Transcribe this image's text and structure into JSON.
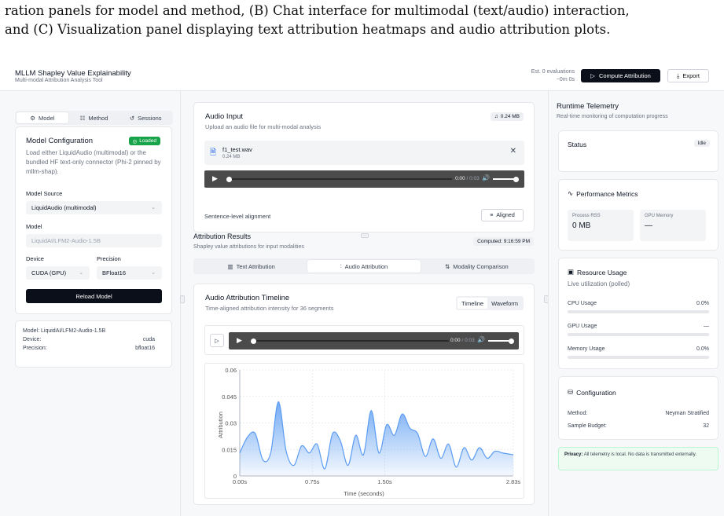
{
  "caption": {
    "line1": "ration panels for model and method, (B) Chat interface for multimodal (text/audio) interaction,",
    "line2": "and (C) Visualization panel displaying text attribution heatmaps and audio attribution plots."
  },
  "header": {
    "title": "MLLM Shapley Value Explainability",
    "subtitle": "Multi-modal Attribution Analysis Tool",
    "est_line1": "Est. 0 evaluations",
    "est_line2": "~0m 0s",
    "compute_label": "Compute Attribution",
    "export_label": "Export"
  },
  "left": {
    "tabs": [
      "Model",
      "Method",
      "Sessions"
    ],
    "config": {
      "title": "Model Configuration",
      "badge": "Loaded",
      "desc": "Load either LiquidAudio (multimodal) or the bundled HF text-only connector (Phi-2 pinned by mllm-shap).",
      "source_label": "Model Source",
      "source_value": "LiquidAudio (multimodal)",
      "model_label": "Model",
      "model_value": "LiquidAI/LFM2-Audio-1.5B",
      "device_label": "Device",
      "device_value": "CUDA (GPU)",
      "precision_label": "Precision",
      "precision_value": "BFloat16",
      "reload_label": "Reload Model"
    },
    "info": {
      "model_k": "Model:",
      "model_v": "LiquidAI/LFM2-Audio-1.5B",
      "device_k": "Device:",
      "device_v": "cuda",
      "precision_k": "Precision:",
      "precision_v": "bfloat16"
    }
  },
  "center": {
    "audio_input": {
      "title": "Audio Input",
      "subtitle": "Upload an audio file for multi-modal analysis",
      "size": "0.24 MB",
      "file_name": "f1_test.wav",
      "file_size": "0.24 MB",
      "time": "0:00",
      "duration": "/ 0:03",
      "alignment_label": "Sentence-level alignment",
      "aligned_label": "Aligned"
    },
    "results": {
      "title": "Attribution Results",
      "subtitle": "Shapley value attributions for input modalities",
      "computed": "Computed: 9:16:59 PM",
      "tabs": [
        "Text Attribution",
        "Audio Attribution",
        "Modality Comparison"
      ]
    },
    "timeline": {
      "title": "Audio Attribution Timeline",
      "subtitle": "Time-aligned attribution intensity for 36 segments",
      "view_timeline": "Timeline",
      "view_waveform": "Waveform",
      "time": "0:00",
      "duration": "/ 0:03"
    }
  },
  "chart_data": {
    "type": "area",
    "xlabel": "Time (seconds)",
    "ylabel": "Attribution",
    "xlim": [
      0,
      2.83
    ],
    "ylim": [
      0,
      0.06
    ],
    "x_ticks": [
      "0.00s",
      "0.75s",
      "1.50s",
      "2.83s"
    ],
    "y_ticks": [
      "0",
      "0.015",
      "0.03",
      "0.045",
      "0.06"
    ],
    "grid": true,
    "color": "#5b9cf2",
    "x": [
      0.0,
      0.08,
      0.16,
      0.24,
      0.32,
      0.4,
      0.48,
      0.56,
      0.64,
      0.72,
      0.8,
      0.88,
      0.96,
      1.04,
      1.12,
      1.2,
      1.28,
      1.36,
      1.44,
      1.52,
      1.6,
      1.68,
      1.76,
      1.84,
      1.92,
      2.0,
      2.08,
      2.16,
      2.24,
      2.32,
      2.4,
      2.48,
      2.56,
      2.64,
      2.72,
      2.83
    ],
    "values": [
      0.013,
      0.022,
      0.024,
      0.009,
      0.013,
      0.042,
      0.014,
      0.006,
      0.017,
      0.013,
      0.018,
      0.004,
      0.024,
      0.02,
      0.006,
      0.023,
      0.012,
      0.037,
      0.013,
      0.029,
      0.023,
      0.035,
      0.027,
      0.024,
      0.011,
      0.021,
      0.01,
      0.018,
      0.005,
      0.016,
      0.009,
      0.016,
      0.01,
      0.014,
      0.013,
      0.012
    ]
  },
  "right": {
    "title": "Runtime Telemetry",
    "subtitle": "Real-time monitoring of computation progress",
    "status_label": "Status",
    "status_value": "Idle",
    "perf_title": "Performance Metrics",
    "rss_label": "Process RSS",
    "rss_value": "0 MB",
    "gpu_label": "GPU Memory",
    "gpu_value": "—",
    "resource_title": "Resource Usage",
    "resource_sub": "Live utilization (polled)",
    "cpu_label": "CPU Usage",
    "cpu_value": "0.0%",
    "cpu_fraction": 0.0,
    "gpu_usage_label": "GPU Usage",
    "gpu_usage_value": "—",
    "mem_label": "Memory Usage",
    "mem_value": "0.0%",
    "mem_fraction": 0.0,
    "config_title": "Configuration",
    "method_k": "Method:",
    "method_v": "Neyman Stratified",
    "budget_k": "Sample Budget:",
    "budget_v": "32",
    "privacy_bold": "Privacy:",
    "privacy_text": "All telemetry is local. No data is transmitted externally."
  }
}
